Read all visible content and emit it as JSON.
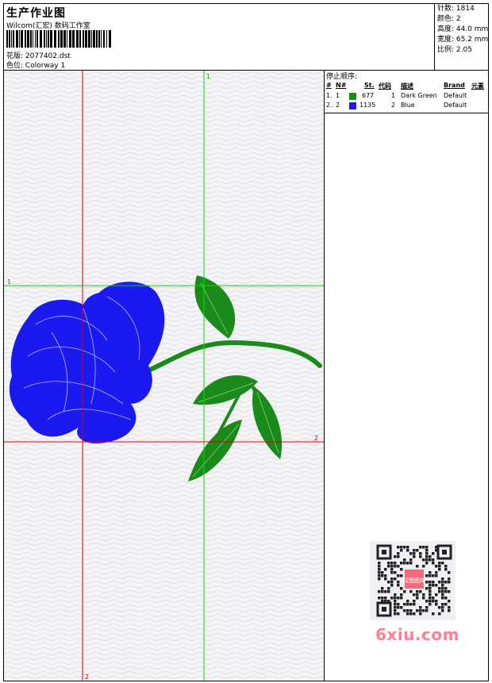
{
  "header": {
    "title": "生产作业图",
    "company": "Wilcom(汇宏) 数码工作室",
    "design_label": "花版:",
    "design_value": "2077402.dst",
    "colorway_label": "色位:",
    "colorway_value": "Colorway 1"
  },
  "stats": {
    "stitches": "针数: 1814",
    "colors": "颜色: 2",
    "height": "高度: 44.0 mm",
    "width": "宽度: 65.2 mm",
    "scale": "比例: 2.05"
  },
  "stop_sequence": {
    "title": "停止顺序:",
    "headers": [
      "#",
      "N#",
      "St.",
      "代码",
      "描述",
      "Brand",
      "元素"
    ],
    "rows": [
      {
        "num": "1.",
        "n": "1",
        "color": "#1a8a1a",
        "st": "677",
        "code": "1",
        "desc": "Dark Green",
        "brand": "Default",
        "element": ""
      },
      {
        "num": "2.",
        "n": "2",
        "color": "#1a1af0",
        "st": "1135",
        "code": "2",
        "desc": "Blue",
        "brand": "Default",
        "element": ""
      }
    ]
  },
  "guides": {
    "green_h_label": "1",
    "green_v_label": "1",
    "red_h_label": "2",
    "red_v_label": "2"
  },
  "watermark": "6xiu.com",
  "qr_badge": "汉图图库",
  "colors": {
    "green_thread": "#1a8a1a",
    "blue_thread": "#1a1af0",
    "guide_green": "#00e000",
    "guide_red": "#e00000"
  }
}
